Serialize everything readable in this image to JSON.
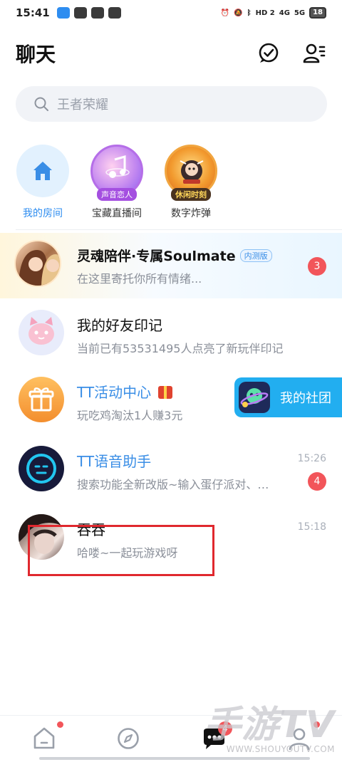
{
  "status_bar": {
    "time": "15:41",
    "network_1": "HD 2",
    "network_2": "4G",
    "network_3": "5G",
    "battery": "18"
  },
  "header": {
    "title": "聊天"
  },
  "search": {
    "placeholder": "王者荣耀"
  },
  "quick_rooms": [
    {
      "label": "我的房间",
      "tag": ""
    },
    {
      "label": "宝藏直播间",
      "tag": "声音恋人"
    },
    {
      "label": "数字炸弹",
      "tag": "休闲时刻"
    }
  ],
  "chats": [
    {
      "title": "灵魂陪伴·专属Soulmate",
      "tag": "内测版",
      "subtitle": "在这里寄托你所有情绪...",
      "time": "",
      "badge": "3"
    },
    {
      "title": "我的好友印记",
      "subtitle": "当前已有53531495人点亮了新玩伴印记",
      "time": "",
      "badge": ""
    },
    {
      "title": "TT活动中心",
      "subtitle": "玩吃鸡淘汰1人赚3元",
      "time": "",
      "badge": ""
    },
    {
      "title": "TT语音助手",
      "subtitle": "搜索功能全新改版~输入蛋仔派对、…",
      "time": "15:26",
      "badge": "4"
    },
    {
      "title": "吞吞",
      "subtitle": "哈喽~一起玩游戏呀",
      "time": "15:18",
      "badge": ""
    }
  ],
  "club_button": {
    "label": "我的社团"
  },
  "bottom_nav": {
    "messages_badge": "4"
  },
  "watermark": {
    "big": "手游TV",
    "small": "WWW.SHOUYOUTV.COM"
  },
  "colors": {
    "accent": "#2e8df0",
    "badge": "#f2555a",
    "club": "#22aef0"
  }
}
